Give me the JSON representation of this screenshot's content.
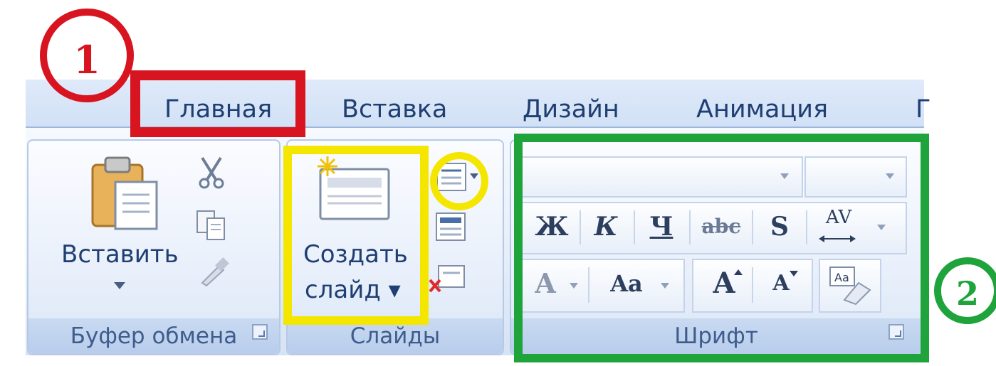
{
  "tabs": [
    "Главная",
    "Вставка",
    "Дизайн",
    "Анимация",
    "Г"
  ],
  "clipboard": {
    "paste_label": "Вставить",
    "group_label": "Буфер обмена"
  },
  "slides": {
    "new_slide_line1": "Создать",
    "new_slide_line2": "слайд ▾",
    "group_label": "Слайды"
  },
  "font": {
    "group_label": "Шрифт",
    "bold": "Ж",
    "italic": "К",
    "underline": "Ч",
    "strike": "abc",
    "shadow": "S",
    "spacing": "AV",
    "font_color": "A",
    "change_case": "Aa",
    "grow": "A",
    "shrink": "A"
  },
  "annotations": {
    "marker_1": "1",
    "marker_2": "2"
  },
  "colors": {
    "red": "#d7141f",
    "yellow": "#f5e600",
    "green": "#1fa33b"
  }
}
